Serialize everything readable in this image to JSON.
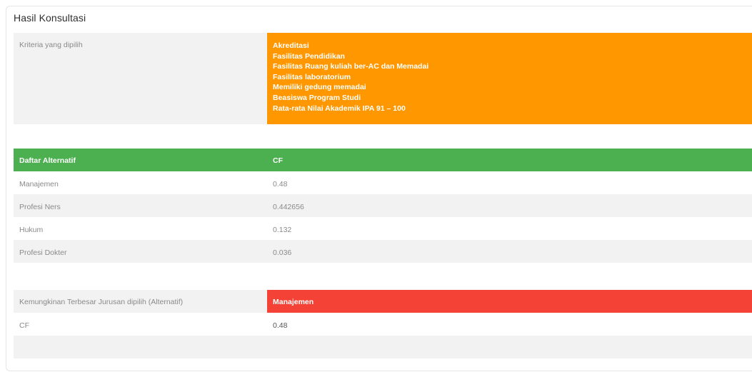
{
  "card": {
    "title": "Hasil Konsultasi"
  },
  "criteria": {
    "label": "Kriteria yang dipilih",
    "items": [
      "Akreditasi",
      "Fasilitas Pendidikan",
      "Fasilitas Ruang kuliah ber-AC dan Memadai",
      "Fasilitas laboratorium",
      "Memiliki gedung memadai",
      "Beasiswa Program Studi",
      "Rata-rata Nilai Akademik IPA 91 – 100"
    ]
  },
  "alternatives_table": {
    "headers": [
      "Daftar Alternatif",
      "CF"
    ],
    "rows": [
      {
        "name": "Manajemen",
        "cf": "0.48"
      },
      {
        "name": "Profesi Ners",
        "cf": "0.442656"
      },
      {
        "name": "Hukum",
        "cf": "0.132"
      },
      {
        "name": "Profesi Dokter",
        "cf": "0.036"
      }
    ]
  },
  "result": {
    "label": "Kemungkinan Terbesar Jurusan dipilih (Alternatif)",
    "value": "Manajemen",
    "cf_label": "CF",
    "cf_value": "0.48"
  },
  "colors": {
    "criteria_bg": "#ff9800",
    "header_bg": "#4caf50",
    "result_bg": "#f44336",
    "stripe_bg": "#f2f2f2"
  }
}
